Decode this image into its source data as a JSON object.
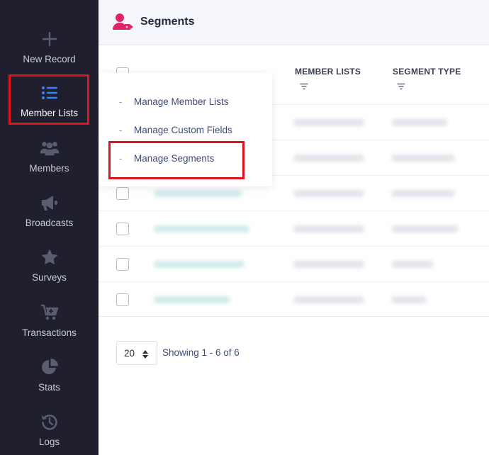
{
  "sidebar": {
    "items": [
      {
        "label": "New Record",
        "icon": "plus-icon"
      },
      {
        "label": "Member Lists",
        "icon": "list-icon",
        "active": true
      },
      {
        "label": "Members",
        "icon": "users-icon"
      },
      {
        "label": "Broadcasts",
        "icon": "megaphone-icon"
      },
      {
        "label": "Surveys",
        "icon": "star-icon"
      },
      {
        "label": "Transactions",
        "icon": "cart-icon"
      },
      {
        "label": "Stats",
        "icon": "pie-chart-icon"
      },
      {
        "label": "Logs",
        "icon": "history-icon"
      }
    ]
  },
  "header": {
    "title": "Segments",
    "icon": "user-tag-icon"
  },
  "table": {
    "columns": [
      "MEMBER LISTS",
      "SEGMENT TYPE"
    ],
    "row_count": 6
  },
  "menu": {
    "items": [
      {
        "label": "Manage Member Lists"
      },
      {
        "label": "Manage Custom Fields"
      },
      {
        "label": "Manage Segments",
        "highlighted": true
      }
    ],
    "dash": "-"
  },
  "pagination": {
    "per_page": "20",
    "showing": "Showing 1 - 6 of 6"
  },
  "colors": {
    "sidebar_bg": "#1f1f2e",
    "accent_blue": "#3b82f6",
    "icon_grey": "#5a5d70",
    "brand_pink": "#e0246a",
    "highlight_red": "#e0141c"
  }
}
